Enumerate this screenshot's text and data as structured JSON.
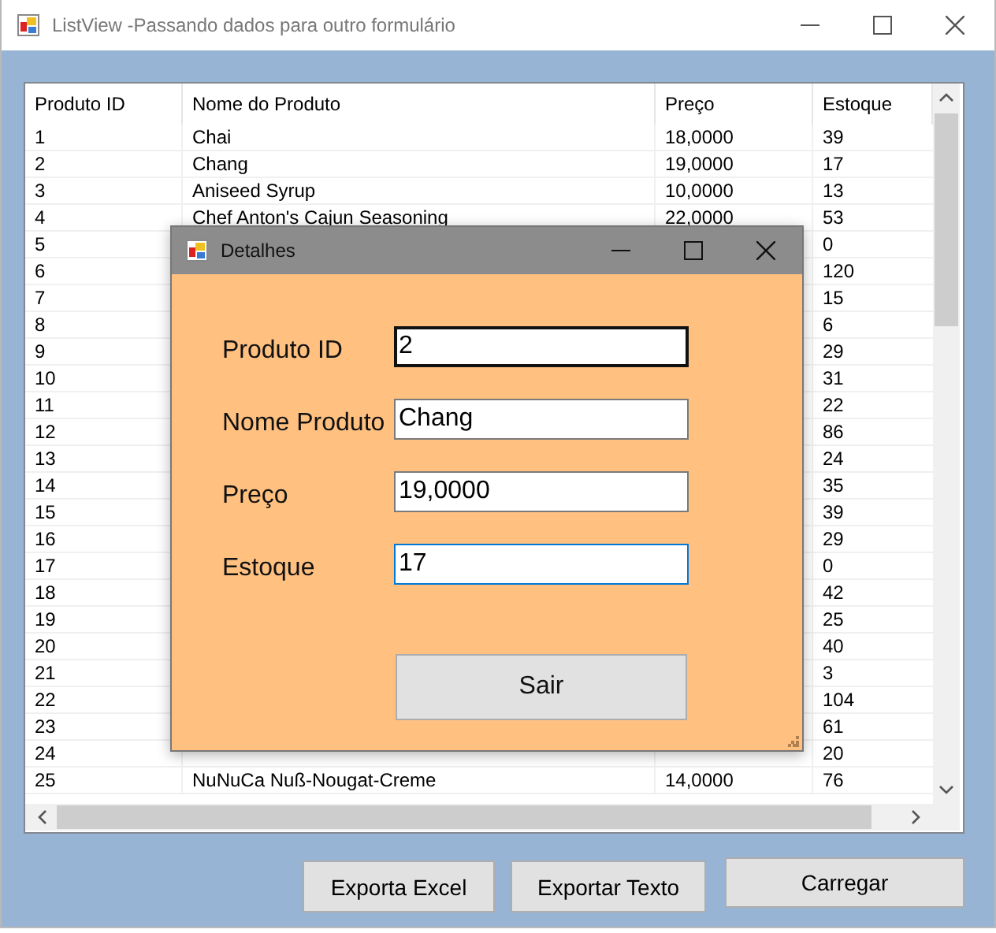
{
  "window": {
    "title": "ListView -Passando dados para outro formulário"
  },
  "table": {
    "columns": [
      "Produto ID",
      "Nome do Produto",
      "Preço",
      "Estoque"
    ],
    "rows": [
      {
        "id": "1",
        "name": "Chai",
        "price": "18,0000",
        "stock": "39"
      },
      {
        "id": "2",
        "name": "Chang",
        "price": "19,0000",
        "stock": "17"
      },
      {
        "id": "3",
        "name": "Aniseed Syrup",
        "price": "10,0000",
        "stock": "13"
      },
      {
        "id": "4",
        "name": "Chef Anton's Cajun Seasoning",
        "price": "22,0000",
        "stock": "53"
      },
      {
        "id": "5",
        "stock": "0"
      },
      {
        "id": "6",
        "stock": "120"
      },
      {
        "id": "7",
        "stock": "15"
      },
      {
        "id": "8",
        "stock": "6"
      },
      {
        "id": "9",
        "stock": "29"
      },
      {
        "id": "10",
        "stock": "31"
      },
      {
        "id": "11",
        "stock": "22"
      },
      {
        "id": "12",
        "stock": "86"
      },
      {
        "id": "13",
        "stock": "24"
      },
      {
        "id": "14",
        "stock": "35"
      },
      {
        "id": "15",
        "stock": "39"
      },
      {
        "id": "16",
        "stock": "29"
      },
      {
        "id": "17",
        "stock": "0"
      },
      {
        "id": "18",
        "stock": "42"
      },
      {
        "id": "19",
        "stock": "25"
      },
      {
        "id": "20",
        "stock": "40"
      },
      {
        "id": "21",
        "stock": "3"
      },
      {
        "id": "22",
        "stock": "104"
      },
      {
        "id": "23",
        "stock": "61"
      },
      {
        "id": "24",
        "stock": "20"
      },
      {
        "id": "25",
        "name": "NuNuCa Nuß-Nougat-Creme",
        "price": "14,0000",
        "stock": "76"
      }
    ]
  },
  "buttons": [
    "Exporta Excel",
    "Exportar Texto",
    "Carregar"
  ],
  "dialog": {
    "title": "Detalhes",
    "fields": [
      {
        "label": "Produto ID",
        "value": "2",
        "focused": false,
        "hovered": true
      },
      {
        "label": "Nome Produto",
        "value": "Chang",
        "focused": false,
        "hovered": false
      },
      {
        "label": "Preço",
        "value": "19,0000",
        "focused": false,
        "hovered": false
      },
      {
        "label": "Estoque",
        "value": "17",
        "focused": true,
        "hovered": false
      }
    ],
    "button": "Sair"
  }
}
